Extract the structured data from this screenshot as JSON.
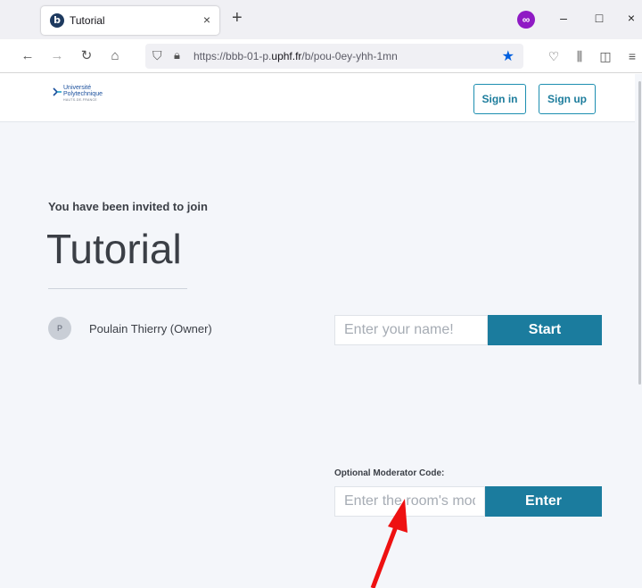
{
  "browser": {
    "tab_title": "Tutorial",
    "tab_favicon_glyph": "b",
    "tab_close": "×",
    "new_tab": "+",
    "url_prefix": "https://bbb-01-p.",
    "url_host": "uphf.fr",
    "url_path": "/b/pou-0ey-yhh-1mn",
    "window_controls": {
      "minimize": "–",
      "maximize": "□",
      "close": "×"
    },
    "nav": {
      "back": "←",
      "forward": "→",
      "reload": "↻",
      "home": "⌂"
    },
    "icons": [
      "shield-icon",
      "lock-icon",
      "bookmark-star-icon",
      "pocket-icon",
      "library-icon",
      "sidebar-icon",
      "menu-icon"
    ]
  },
  "site": {
    "logo": {
      "line1": "Université",
      "line2": "Polytechnique",
      "line3": "HAUTS-DE-FRANCE"
    },
    "sign_in": "Sign in",
    "sign_up": "Sign up"
  },
  "room": {
    "invite_text": "You have been invited to join",
    "title": "Tutorial",
    "owner_initial": "P",
    "owner_name": "Poulain Thierry (Owner)",
    "name_placeholder": "Enter your name!",
    "start_label": "Start",
    "moderator_label": "Optional Moderator Code:",
    "moderator_placeholder": "Enter the room's moderator code",
    "enter_label": "Enter"
  },
  "colors": {
    "accent": "#1b7c9e",
    "annotation_arrow": "#ee1111"
  }
}
